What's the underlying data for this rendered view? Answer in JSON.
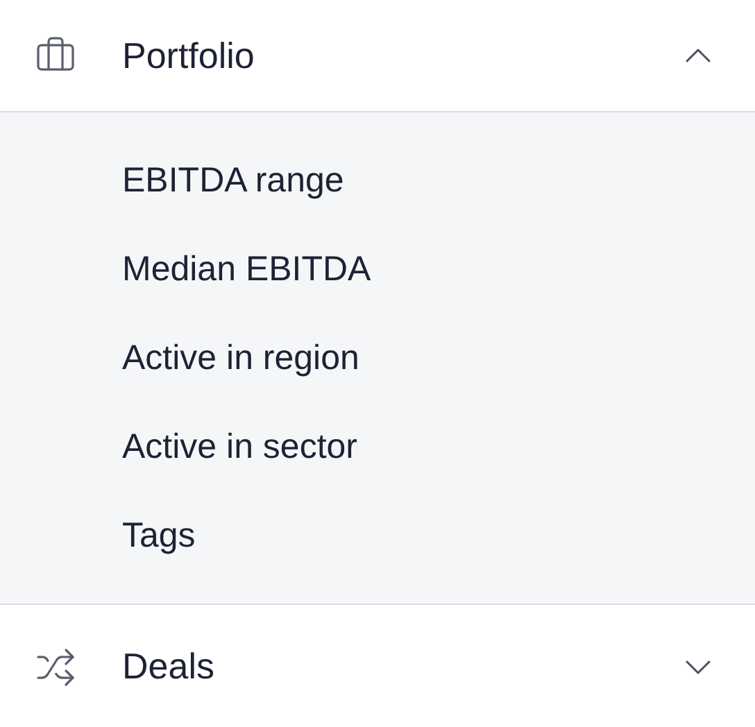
{
  "sections": [
    {
      "label": "Portfolio",
      "kind": "briefcase",
      "expanded": true,
      "items": [
        {
          "label": "EBITDA range"
        },
        {
          "label": "Median EBITDA"
        },
        {
          "label": "Active in region"
        },
        {
          "label": "Active in sector"
        },
        {
          "label": "Tags"
        }
      ]
    },
    {
      "label": "Deals",
      "kind": "shuffle",
      "expanded": false
    }
  ]
}
